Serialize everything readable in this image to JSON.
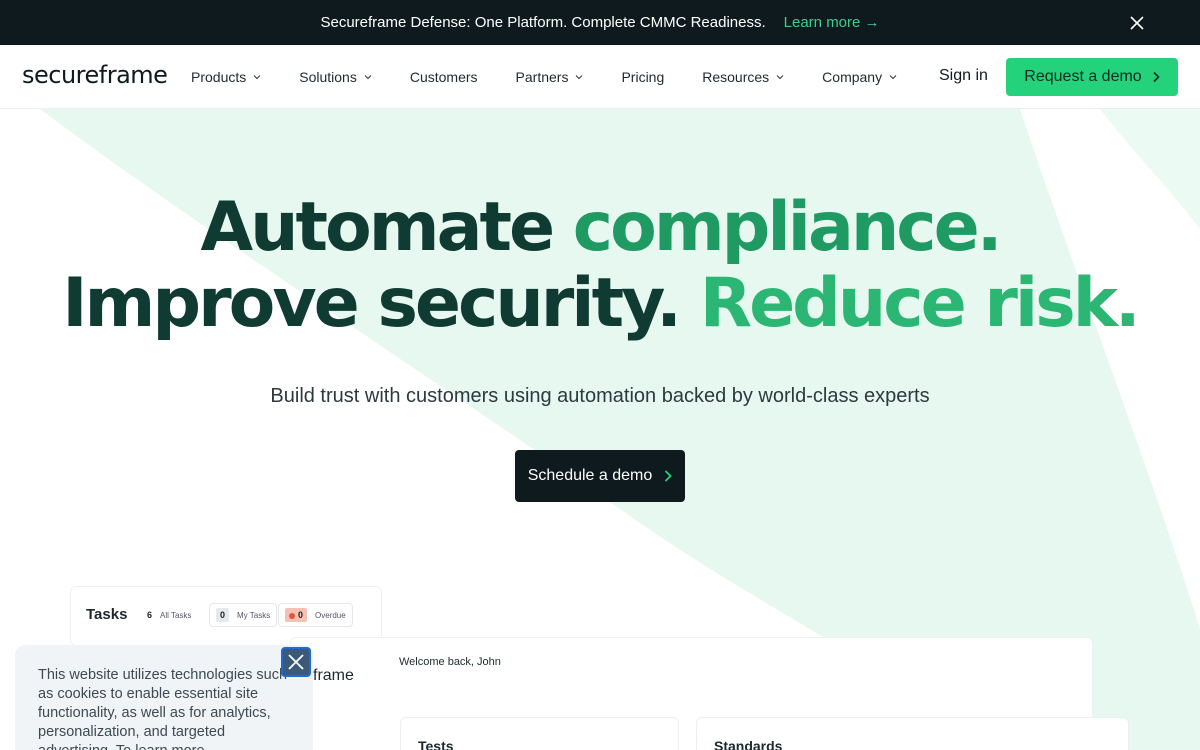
{
  "announcement": {
    "message": "Secureframe Defense: One Platform. Complete CMMC Readiness.",
    "link": "Learn more →"
  },
  "nav": {
    "logo": "secureframe",
    "items": [
      {
        "label": "Products",
        "has_dropdown": true
      },
      {
        "label": "Solutions",
        "has_dropdown": true
      },
      {
        "label": "Customers",
        "has_dropdown": false
      },
      {
        "label": "Partners",
        "has_dropdown": true
      },
      {
        "label": "Pricing",
        "has_dropdown": false
      },
      {
        "label": "Resources",
        "has_dropdown": true
      },
      {
        "label": "Company",
        "has_dropdown": true
      }
    ],
    "sign_in": "Sign in",
    "request_demo": "Request a demo"
  },
  "hero": {
    "line1_a": "Automate",
    "line1_b": "compliance.",
    "line2_a": "Improve security.",
    "line2_b": "Reduce risk.",
    "subhead": "Build trust with customers using automation backed by world-class experts",
    "cta": "Schedule a demo"
  },
  "preview": {
    "tasks_title": "Tasks",
    "all_tasks_count": "6",
    "all_tasks_label": "All Tasks",
    "my_tasks_count": "0",
    "my_tasks_label": "My Tasks",
    "overdue_count": "0",
    "overdue_label": "Overdue",
    "app_name_fragment": "frame",
    "welcome": "Welcome back, John",
    "tests_label": "Tests",
    "standards_label": "Standards"
  },
  "cookie": {
    "text": "This website utilizes technologies such as cookies to enable essential site functionality, as well as for analytics, personalization, and targeted advertising. To learn more"
  },
  "colors": {
    "accent_green": "#24d27c",
    "dark": "#0f1a1f",
    "headline_dark": "#0f3b33",
    "headline_green": "#1f9a63"
  }
}
